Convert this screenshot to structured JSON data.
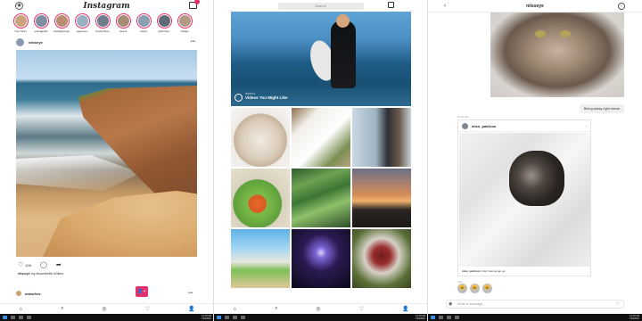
{
  "feed": {
    "app_title": "Instagram",
    "stories": [
      {
        "name": "Your Story",
        "color": "#c9a47c"
      },
      {
        "name": "joshtagelist",
        "color": "#7d8fa0"
      },
      {
        "name": "hashtagmvgs",
        "color": "#b88d71"
      },
      {
        "name": "yaguesoo",
        "color": "#9ab0c5"
      },
      {
        "name": "beckyshine",
        "color": "#6f7e8d"
      },
      {
        "name": "steev3",
        "color": "#a88c74"
      },
      {
        "name": "kayla",
        "color": "#8aa0b2"
      },
      {
        "name": "jkjohnson",
        "color": "#5e6a76"
      },
      {
        "name": "imtiago",
        "color": "#b39a86"
      }
    ],
    "post": {
      "username": "niisseye",
      "likes": "106",
      "caption_user": "niisseye",
      "caption_text": "my #waveforlife #2likes"
    },
    "next_post_username": "mtwofrev",
    "fab_icon": "👤+",
    "nav_icons": [
      "⌂",
      "⌕",
      "◎",
      "♡",
      "👤"
    ],
    "taskbar": {
      "time": "10:30 AM",
      "date": "7/19/2016"
    }
  },
  "explore": {
    "search_placeholder": "Search",
    "video_subtitle": "WATCH",
    "video_title": "Videos You Might Like",
    "nav_icons": [
      "⌂",
      "⌕",
      "◎",
      "♡",
      "👤"
    ],
    "taskbar": {
      "time": "10:30 AM",
      "date": "7/19/2016"
    }
  },
  "direct": {
    "conversation_title": "niisseye",
    "message_text": "Being sassy right meow",
    "timestamp": "10:30 AM",
    "shared_post": {
      "username": "miso_patrison",
      "caption_user": "miso_patrison",
      "caption_text": "I don't wanna get up"
    },
    "reactor": "miso",
    "reactions": [
      "😺",
      "😺",
      "😺"
    ],
    "composer_placeholder": "Write a message...",
    "taskbar": {
      "time": "10:30 AM",
      "date": "7/19/2016"
    }
  }
}
